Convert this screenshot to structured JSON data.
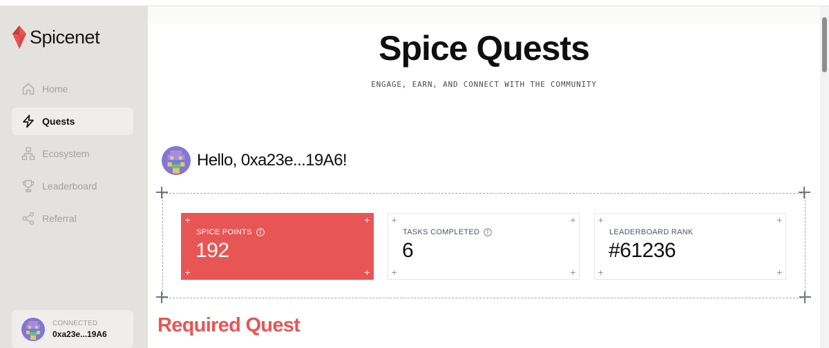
{
  "app": {
    "brand": "Spicenet"
  },
  "sidebar": {
    "items": [
      {
        "label": "Home",
        "icon": "home-icon",
        "active": false
      },
      {
        "label": "Quests",
        "icon": "lightning-icon",
        "active": true
      },
      {
        "label": "Ecosystem",
        "icon": "hierarchy-icon",
        "active": false
      },
      {
        "label": "Leaderboard",
        "icon": "trophy-icon",
        "active": false
      },
      {
        "label": "Referral",
        "icon": "share-icon",
        "active": false
      }
    ],
    "wallet": {
      "status": "CONNECTED",
      "address": "0xa23e...19A6"
    }
  },
  "main": {
    "title": "Spice Quests",
    "subtitle": "ENGAGE, EARN, AND CONNECT WITH THE COMMUNITY",
    "greeting": "Hello, 0xa23e...19A6!",
    "stats": [
      {
        "label": "SPICE POINTS",
        "value": "192",
        "info": true
      },
      {
        "label": "TASKS COMPLETED",
        "value": "6",
        "info": true
      },
      {
        "label": "LEADERBOARD RANK",
        "value": "#61236",
        "info": false
      }
    ],
    "section_title": "Required Quest"
  },
  "colors": {
    "accent": "#e85555",
    "sidebar_bg": "#e4e2de",
    "active_item_bg": "#efeeec"
  }
}
